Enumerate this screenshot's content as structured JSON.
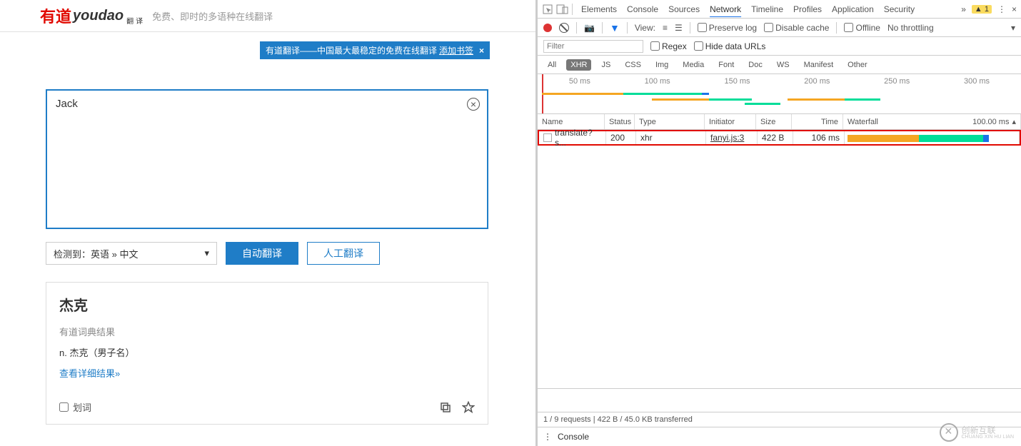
{
  "app": {
    "logo_primary": "有道",
    "logo_pinyin": "youdao",
    "logo_sub": "翻译",
    "slogan": "免费、即时的多语种在线翻译",
    "banner_main": "有道翻译——中国最大最稳定的免费在线翻译",
    "banner_link": "添加书签",
    "input_text": "Jack",
    "lang_select": "检测到：英语 » 中文",
    "btn_auto": "自动翻译",
    "btn_manual": "人工翻译",
    "result_word": "杰克",
    "dict_label": "有道词典结果",
    "definition": "n. 杰克（男子名）",
    "more_link": "查看详细结果»",
    "huaci": "划词"
  },
  "dev": {
    "tabs": [
      "Elements",
      "Console",
      "Sources",
      "Network",
      "Timeline",
      "Profiles",
      "Application",
      "Security"
    ],
    "active_tab": "Network",
    "warn_count": "1",
    "view_label": "View:",
    "preserve": "Preserve log",
    "disable_cache": "Disable cache",
    "offline": "Offline",
    "throttling": "No throttling",
    "filter_placeholder": "Filter",
    "regex": "Regex",
    "hide_data": "Hide data URLs",
    "types": [
      "All",
      "XHR",
      "JS",
      "CSS",
      "Img",
      "Media",
      "Font",
      "Doc",
      "WS",
      "Manifest",
      "Other"
    ],
    "active_type": "XHR",
    "ticks": [
      "50 ms",
      "100 ms",
      "150 ms",
      "200 ms",
      "250 ms",
      "300 ms"
    ],
    "grid_headers": {
      "name": "Name",
      "status": "Status",
      "type": "Type",
      "initiator": "Initiator",
      "size": "Size",
      "time": "Time",
      "waterfall": "Waterfall",
      "waterfall_val": "100.00 ms"
    },
    "row": {
      "name": "translate?s...",
      "status": "200",
      "type": "xhr",
      "initiator": "fanyi.js:3",
      "size": "422 B",
      "time": "106 ms"
    },
    "status_bar": "1 / 9 requests  |  422 B / 45.0 KB transferred",
    "drawer_tab": "Console"
  },
  "watermark": {
    "line1": "创新互联",
    "line2": "CHUANG XIN HU LIAN"
  }
}
